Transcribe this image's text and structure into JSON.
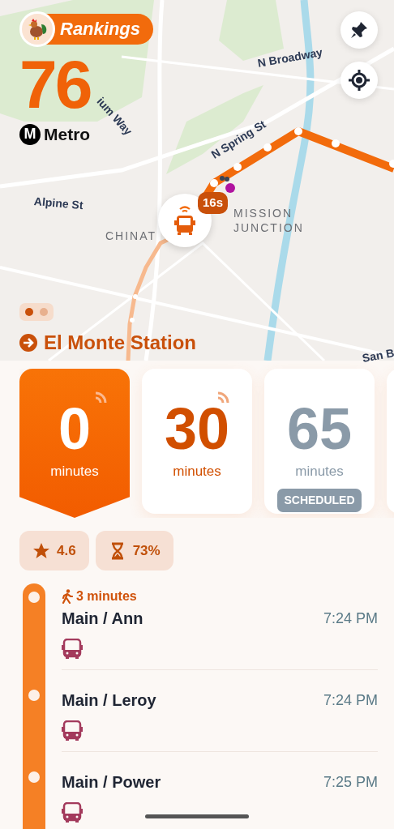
{
  "header": {
    "rankings_label": "Rankings",
    "route_number": "76",
    "agency_logo_letter": "M",
    "agency": "Metro"
  },
  "map": {
    "labels": [
      {
        "text": "N Broadway"
      },
      {
        "text": "N Spring St"
      },
      {
        "text": "ium Way"
      },
      {
        "text": "Alpine St"
      },
      {
        "text": "CHINAT"
      },
      {
        "text": "MISSION JUNCTION"
      },
      {
        "text": "San B"
      }
    ],
    "vehicle": {
      "badge": "16s"
    }
  },
  "pager": {
    "pages": [
      {
        "selected": true
      },
      {
        "selected": false
      }
    ]
  },
  "destination": "El Monte Station",
  "arrivals": [
    {
      "minutes": "0",
      "unit": "minutes",
      "selected": true,
      "realtime": true
    },
    {
      "minutes": "30",
      "unit": "minutes",
      "selected": false,
      "realtime": true
    },
    {
      "minutes": "65",
      "unit": "minutes",
      "selected": false,
      "realtime": false,
      "status": "SCHEDULED"
    }
  ],
  "stats": [
    {
      "kind": "rating",
      "value": "4.6"
    },
    {
      "kind": "reliability",
      "value": "73%"
    }
  ],
  "walk": "3 minutes",
  "stops": [
    {
      "name": "Main / Ann",
      "time": "7:24 PM"
    },
    {
      "name": "Main / Leroy",
      "time": "7:24 PM"
    },
    {
      "name": "Main / Power",
      "time": "7:25 PM"
    }
  ]
}
